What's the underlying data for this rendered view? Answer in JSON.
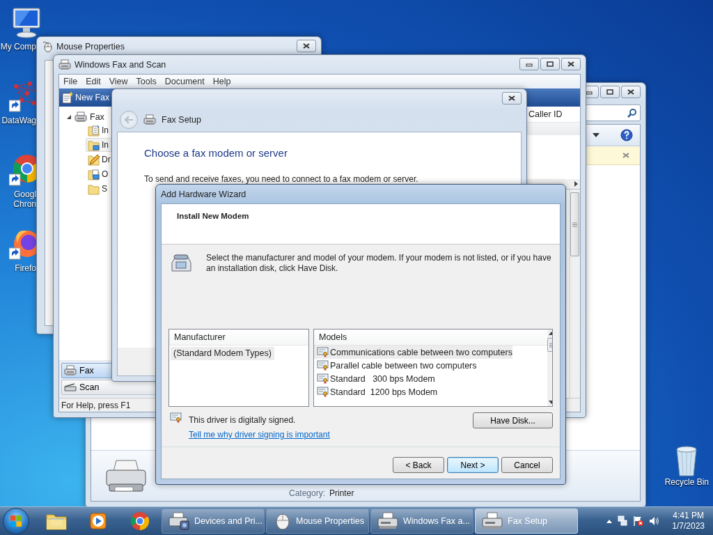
{
  "desktop_icons": [
    {
      "lines": [
        "My Comp"
      ],
      "kind": "computer"
    },
    {
      "lines": [
        "DataWag"
      ],
      "kind": "datawag"
    },
    {
      "lines": [
        "Googl",
        "Chron"
      ],
      "kind": "chrome"
    },
    {
      "lines": [
        "Firefo"
      ],
      "kind": "firefox"
    }
  ],
  "recycle_bin": {
    "label": "Recycle Bin"
  },
  "devices_window": {
    "category_label": "Category:",
    "category_value": "Printer"
  },
  "mouse_properties": {
    "title": "Mouse Properties"
  },
  "fax_scan": {
    "title": "Windows Fax and Scan",
    "menu": [
      "File",
      "Edit",
      "View",
      "Tools",
      "Document",
      "Help"
    ],
    "new_fax": "New Fax",
    "tree": {
      "label": "Fax",
      "expanded": true,
      "children": [
        {
          "label": "In",
          "kind": "incoming",
          "selected": false
        },
        {
          "label": "In",
          "kind": "inbox",
          "selected": true
        },
        {
          "label": "Dr",
          "kind": "drafts",
          "selected": false
        },
        {
          "label": "O",
          "kind": "outbox",
          "selected": false
        },
        {
          "label": "S",
          "kind": "sent",
          "selected": false
        }
      ]
    },
    "columns": [
      "Caller ID"
    ],
    "nav": [
      {
        "label": "Fax",
        "kind": "fax",
        "selected": true
      },
      {
        "label": "Scan",
        "kind": "scan",
        "selected": false
      }
    ],
    "status": "For Help, press F1"
  },
  "fax_setup": {
    "title": "Fax Setup",
    "heading": "Choose a fax modem or server",
    "text": "To send and receive faxes, you need to connect to a fax modem or server."
  },
  "wizard": {
    "title": "Add Hardware Wizard",
    "header": "Install New Modem",
    "instructions": "Select the manufacturer and model of your modem. If your modem is not listed, or if you have an installation disk, click Have Disk.",
    "manufacturer_header": "Manufacturer",
    "manufacturers": [
      {
        "label": "(Standard Modem Types)",
        "selected": true
      }
    ],
    "models_header": "Models",
    "models": [
      {
        "label": "Communications cable between two computers",
        "selected": true
      },
      {
        "label": "Parallel cable between two computers",
        "selected": false
      },
      {
        "label": "Standard   300 bps Modem",
        "selected": false
      },
      {
        "label": "Standard  1200 bps Modem",
        "selected": false
      }
    ],
    "signature": "This driver is digitally signed.",
    "link": "Tell me why driver signing is important",
    "have_disk": "Have Disk...",
    "buttons": [
      {
        "label": "< Back",
        "default": false
      },
      {
        "label": "Next >",
        "default": true
      },
      {
        "label": "Cancel",
        "default": false
      }
    ]
  },
  "taskbar": {
    "pinned": [
      {
        "kind": "explorer"
      },
      {
        "kind": "media"
      },
      {
        "kind": "chrome"
      }
    ],
    "tasks": [
      {
        "label": "Devices and Pri...",
        "kind": "devices",
        "selected": false
      },
      {
        "label": "Mouse Properties",
        "kind": "mouse",
        "selected": false
      },
      {
        "label": "Windows Fax a...",
        "kind": "fax",
        "selected": false
      },
      {
        "label": "Fax Setup",
        "kind": "fax",
        "selected": true
      }
    ],
    "time": "4:41 PM",
    "date": "1/7/2023"
  }
}
